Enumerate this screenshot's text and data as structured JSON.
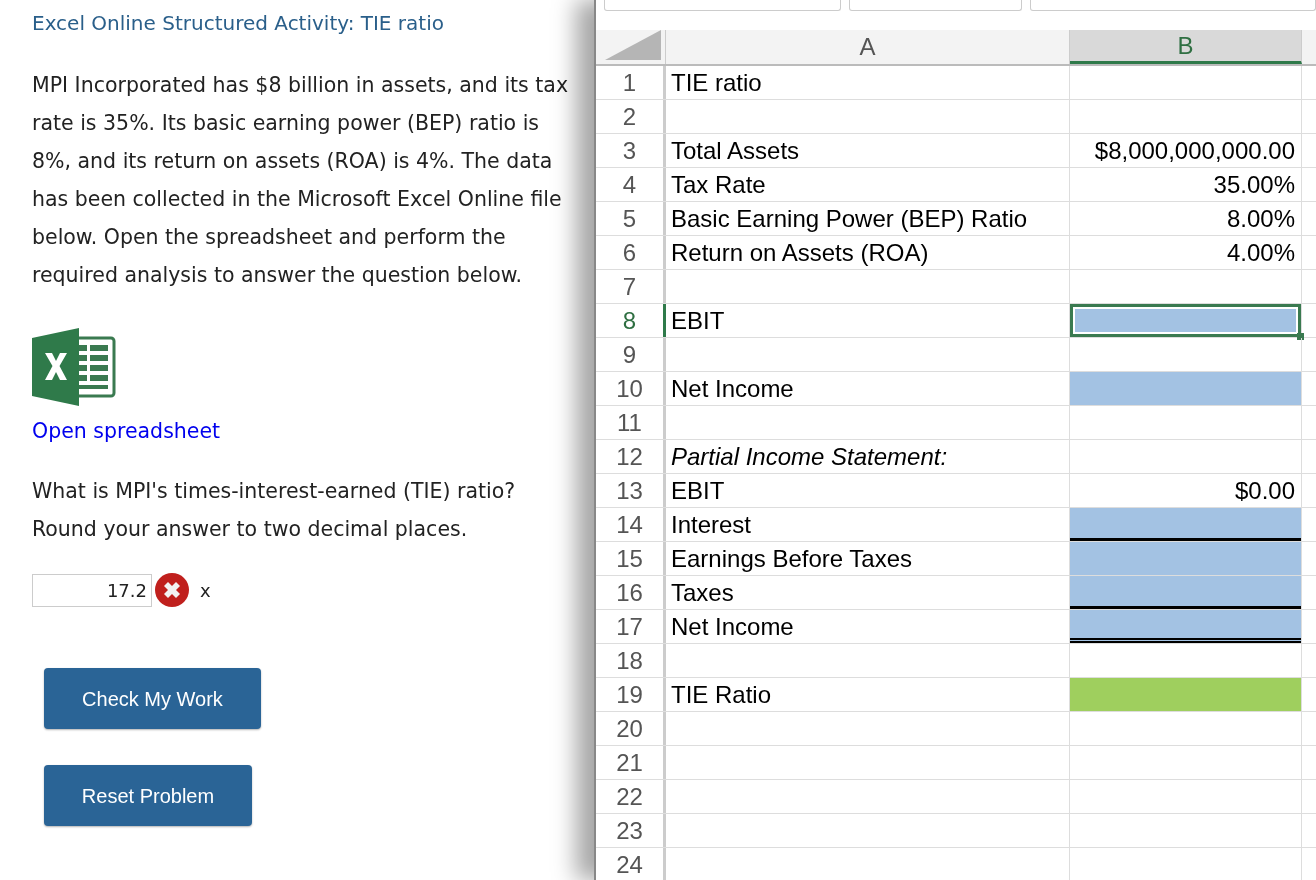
{
  "activity": {
    "title": "Excel Online Structured Activity: TIE ratio",
    "intro": "MPI Incorporated has $8 billion in assets, and its tax rate is 35%. Its basic earning power (BEP) ratio is 8%, and its return on assets (ROA) is 4%. The data has been collected in the Microsoft Excel Online file below. Open the spreadsheet and perform the required analysis to answer the question below.",
    "link": "Open spreadsheet",
    "question": "What is MPI's times-interest-earned (TIE) ratio? Round your answer to two decimal places.",
    "answer": {
      "value": "17.2",
      "correct": false,
      "mark": "x"
    },
    "buttons": [
      "Check My Work",
      "Reset Problem"
    ]
  },
  "sheet": {
    "columns": [
      {
        "label": "A",
        "selected": false
      },
      {
        "label": "B",
        "selected": true
      }
    ],
    "rows": [
      {
        "number": "1",
        "selected": false,
        "a": {
          "text": "TIE ratio",
          "italic": false
        }
      },
      {
        "number": "2",
        "selected": false
      },
      {
        "number": "3",
        "selected": false,
        "a": {
          "text": "Total Assets",
          "italic": false
        },
        "b": {
          "text": "$8,000,000,000.00"
        }
      },
      {
        "number": "4",
        "selected": false,
        "a": {
          "text": "Tax Rate",
          "italic": false
        },
        "b": {
          "text": "35.00%"
        }
      },
      {
        "number": "5",
        "selected": false,
        "a": {
          "text": "Basic Earning Power (BEP) Ratio",
          "italic": false
        },
        "b": {
          "text": "8.00%"
        }
      },
      {
        "number": "6",
        "selected": false,
        "a": {
          "text": "Return on Assets (ROA)",
          "italic": false
        },
        "b": {
          "text": "4.00%"
        }
      },
      {
        "number": "7",
        "selected": false
      },
      {
        "number": "8",
        "selected": true,
        "a": {
          "text": "EBIT",
          "italic": false
        },
        "b": {
          "kind": "input",
          "active": true,
          "underlined": false,
          "double_underlined": false
        }
      },
      {
        "number": "9",
        "selected": false
      },
      {
        "number": "10",
        "selected": false,
        "a": {
          "text": "Net Income",
          "italic": false
        },
        "b": {
          "kind": "input",
          "active": false,
          "underlined": false,
          "double_underlined": false
        }
      },
      {
        "number": "11",
        "selected": false
      },
      {
        "number": "12",
        "selected": false,
        "a": {
          "text": "Partial Income Statement:",
          "italic": true
        }
      },
      {
        "number": "13",
        "selected": false,
        "a": {
          "text": "EBIT",
          "italic": false
        },
        "b": {
          "text": "$0.00"
        }
      },
      {
        "number": "14",
        "selected": false,
        "a": {
          "text": "Interest",
          "italic": false
        },
        "b": {
          "kind": "input",
          "active": false,
          "underlined": true,
          "double_underlined": false
        }
      },
      {
        "number": "15",
        "selected": false,
        "a": {
          "text": "Earnings Before Taxes",
          "italic": false
        },
        "b": {
          "kind": "input",
          "active": false,
          "underlined": false,
          "double_underlined": false
        }
      },
      {
        "number": "16",
        "selected": false,
        "a": {
          "text": "Taxes",
          "italic": false
        },
        "b": {
          "kind": "input",
          "active": false,
          "underlined": true,
          "double_underlined": false
        }
      },
      {
        "number": "17",
        "selected": false,
        "a": {
          "text": "Net Income",
          "italic": false
        },
        "b": {
          "kind": "input",
          "active": false,
          "underlined": false,
          "double_underlined": true
        }
      },
      {
        "number": "18",
        "selected": false
      },
      {
        "number": "19",
        "selected": false,
        "a": {
          "text": "TIE Ratio",
          "italic": false
        },
        "b": {
          "kind": "result",
          "active": false,
          "underlined": false,
          "double_underlined": false
        }
      },
      {
        "number": "20",
        "selected": false
      },
      {
        "number": "21",
        "selected": false
      },
      {
        "number": "22",
        "selected": false
      },
      {
        "number": "23",
        "selected": false
      },
      {
        "number": "24",
        "selected": false
      }
    ]
  }
}
